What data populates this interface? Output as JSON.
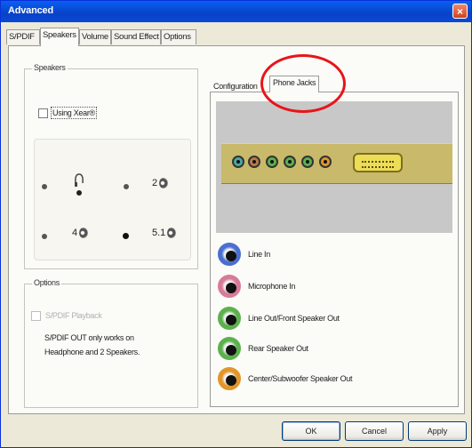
{
  "window": {
    "title": "Advanced",
    "close_glyph": "×"
  },
  "tabs": [
    "S/PDIF",
    "Speakers",
    "Volume",
    "Sound Effect",
    "Options"
  ],
  "speakers_group": {
    "legend": "Speakers",
    "using_xear_label": "Using Xear®",
    "options": [
      "2",
      "4",
      "5.1"
    ],
    "selected": "5.1"
  },
  "options_group": {
    "legend": "Options",
    "spdif_playback_label": "S/PDIF Playback",
    "note_line1": "S/PDIF OUT only works on",
    "note_line2": "Headphone and 2 Speakers."
  },
  "subtabs": [
    "Configuration",
    "Phone Jacks"
  ],
  "jacks": [
    {
      "label": "Line In",
      "color": "#4a6fd0"
    },
    {
      "label": "Microphone In",
      "color": "#d87a9a"
    },
    {
      "label": "Line Out/Front Speaker Out",
      "color": "#5db04e"
    },
    {
      "label": "Rear Speaker Out",
      "color": "#5db04e"
    },
    {
      "label": "Center/Subwoofer Speaker Out",
      "color": "#e0962a"
    }
  ],
  "card_jack_colors": [
    "#4aa8a0",
    "#b87a4a",
    "#5db04e",
    "#5db04e",
    "#5db04e",
    "#e0962a"
  ],
  "buttons": {
    "ok": "OK",
    "cancel": "Cancel",
    "apply": "Apply"
  },
  "highlight_color": "#e8141a"
}
